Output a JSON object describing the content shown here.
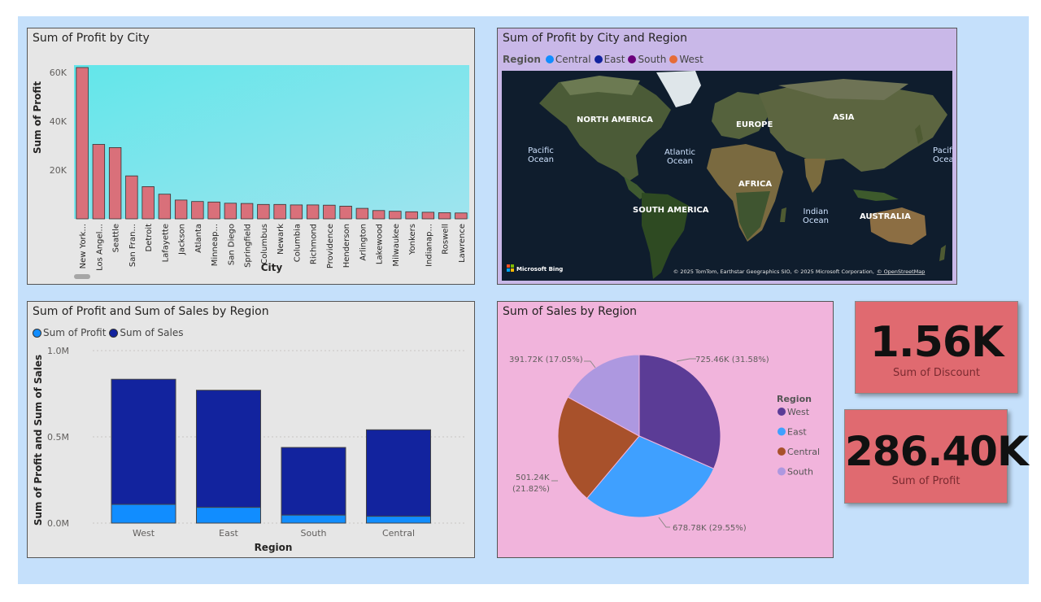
{
  "chart_data": [
    {
      "type": "bar",
      "title": "Sum of Profit by City",
      "xlabel": "City",
      "ylabel": "Sum of Profit",
      "ylim": [
        0,
        63000
      ],
      "yticks": [
        "20K",
        "40K",
        "60K"
      ],
      "ytick_values": [
        20000,
        40000,
        60000
      ],
      "grid": false,
      "categories": [
        "New York...",
        "Los Angel...",
        "Seattle",
        "San Fran...",
        "Detroit",
        "Lafayette",
        "Jackson",
        "Atlanta",
        "Minneap...",
        "San Diego",
        "Springfield",
        "Columbus",
        "Newark",
        "Columbia",
        "Richmond",
        "Providence",
        "Henderson",
        "Arlington",
        "Lakewood",
        "Milwaukee",
        "Yonkers",
        "Indianap...",
        "Roswell",
        "Lawrence"
      ],
      "values": [
        62000,
        30500,
        29200,
        17600,
        13200,
        10100,
        7700,
        7100,
        6900,
        6400,
        6300,
        5900,
        5900,
        5700,
        5700,
        5600,
        5200,
        4300,
        3400,
        3100,
        2900,
        2700,
        2500,
        2400
      ],
      "colors": {
        "bar": "#d9707a",
        "plot_bg": "#75e3ea"
      }
    },
    {
      "type": "map",
      "title": "Sum of Profit by City and Region",
      "legend_title": "Region",
      "legend": [
        {
          "name": "Central",
          "color": "#118dff"
        },
        {
          "name": "East",
          "color": "#12239e"
        },
        {
          "name": "South",
          "color": "#6b007b"
        },
        {
          "name": "West",
          "color": "#e66c37"
        }
      ],
      "labels": {
        "north_america": "NORTH AMERICA",
        "europe": "EUROPE",
        "asia": "ASIA",
        "africa": "AFRICA",
        "south_america": "SOUTH AMERICA",
        "australia": "AUSTRALIA",
        "pacific1": "Pacific",
        "pacific2": "Ocean",
        "pacific_right1": "Pacifi",
        "pacific_right2": "Ocea",
        "atlantic1": "Atlantic",
        "atlantic2": "Ocean",
        "indian1": "Indian",
        "indian2": "Ocean"
      },
      "brand": "Microsoft Bing",
      "copyright": "© 2025 TomTom, Earthstar Geographics SIO, © 2025 Microsoft Corporation,",
      "copyright_link": "© OpenStreetMap"
    },
    {
      "type": "bar",
      "stacked": true,
      "title": "Sum of Profit and Sum of Sales by Region",
      "xlabel": "Region",
      "ylabel": "Sum of Profit and Sum of Sales",
      "ylim": [
        0,
        1000000
      ],
      "yticks": [
        "0.0M",
        "0.5M",
        "1.0M"
      ],
      "ytick_values": [
        0,
        500000,
        1000000
      ],
      "grid": true,
      "legend_position": "top-left",
      "categories": [
        "West",
        "East",
        "South",
        "Central"
      ],
      "series": [
        {
          "name": "Sum of Profit",
          "color": "#118dff",
          "values": [
            108420,
            91523,
            46749,
            39706
          ]
        },
        {
          "name": "Sum of Sales",
          "color": "#12239e",
          "values": [
            725460,
            678780,
            391720,
            501240
          ]
        }
      ]
    },
    {
      "type": "pie",
      "title": "Sum of Sales by Region",
      "legend_title": "Region",
      "legend_position": "right",
      "slices": [
        {
          "name": "West",
          "value": 725460,
          "pct": 31.58,
          "label": "725.46K (31.58%)",
          "color": "#5b3c96"
        },
        {
          "name": "East",
          "value": 678780,
          "pct": 29.55,
          "label": "678.78K (29.55%)",
          "color": "#3fa0ff"
        },
        {
          "name": "Central",
          "value": 501240,
          "pct": 21.82,
          "label1": "501.24K",
          "label2": "(21.82%)",
          "color": "#a8512b"
        },
        {
          "name": "South",
          "value": 391720,
          "pct": 17.05,
          "label": "391.72K (17.05%)",
          "color": "#ad98e0"
        }
      ]
    }
  ],
  "cards": {
    "discount": {
      "value": "1.56K",
      "label": "Sum of Discount"
    },
    "profit": {
      "value": "286.40K",
      "label": "Sum of Profit"
    }
  },
  "colors": {
    "canvas_bg": "#c5e0fb",
    "panel_grey": "#e6e6e6",
    "map_panel": "#c9b8e8",
    "pie_panel": "#f1b4dc",
    "card": "#e06a70"
  }
}
